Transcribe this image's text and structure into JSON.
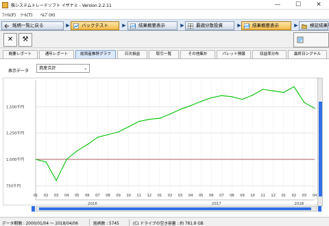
{
  "window": {
    "title": "株システムトレードソフト イザナミ - Version 2.2.11",
    "controls": [
      "—",
      "☐",
      "✕"
    ]
  },
  "menu": [
    "ﾌｧｲﾙ(F)",
    "ﾂｰﾙ(T)",
    "ﾍﾙﾌﾟ(H)"
  ],
  "nav": {
    "back": "銘柄一覧に戻る",
    "backtest": "バックテスト",
    "result_summary": "結果概要表示",
    "optimal_split": "最適分散投資",
    "active_summary": "結果概要表示",
    "verify_result": "検証結果を"
  },
  "tabs": [
    {
      "label": "概要レポート",
      "active": false
    },
    {
      "label": "通年レポート",
      "active": false
    },
    {
      "label": "総資産推移グラフ",
      "active": true
    },
    {
      "label": "日次損益",
      "active": false
    },
    {
      "label": "取引一覧",
      "active": false
    },
    {
      "label": "その他集計",
      "active": false
    },
    {
      "label": "パレット情報",
      "active": false
    },
    {
      "label": "収益率分布",
      "active": false
    },
    {
      "label": "最終日シグナル",
      "active": false
    }
  ],
  "display_data": {
    "label": "表示データ",
    "value": "資産合計"
  },
  "colors": {
    "line": "#00c000",
    "baseline": "#9a2a2a",
    "grid": "#d8d8d8",
    "accent": "#2f6ee6"
  },
  "chart_data": {
    "type": "line",
    "series": [
      {
        "name": "",
        "x": [
          "2016-01",
          "2016-02",
          "2016-03",
          "2016-04",
          "2016-05",
          "2016-06",
          "2016-07",
          "2016-08",
          "2016-09",
          "2016-10",
          "2016-11",
          "2016-12",
          "2017-01",
          "2017-02",
          "2017-03",
          "2017-04",
          "2017-05",
          "2017-06",
          "2017-07",
          "2017-08",
          "2017-09",
          "2017-10",
          "2017-11",
          "2017-12",
          "2018-01",
          "2018-02",
          "2018-03",
          "2018-04"
        ],
        "values": [
          1000,
          975,
          800,
          1000,
          1080,
          1140,
          1210,
          1235,
          1260,
          1310,
          1360,
          1380,
          1390,
          1430,
          1475,
          1510,
          1550,
          1585,
          1605,
          1595,
          1570,
          1610,
          1665,
          1650,
          1635,
          1690,
          1540,
          1485
        ]
      }
    ],
    "y_ticks": [
      "750千円",
      "1,000千円",
      "1,250千円",
      "1,500千円"
    ],
    "x_tick_labels": [
      "01",
      "02",
      "03",
      "04",
      "05",
      "06",
      "07",
      "08",
      "09",
      "10",
      "11",
      "12",
      "01",
      "02",
      "03",
      "04",
      "05",
      "06",
      "07",
      "08",
      "09",
      "10",
      "11",
      "12",
      "01",
      "02",
      "03",
      "04"
    ],
    "year_labels": [
      "2016",
      "2017",
      "2018"
    ],
    "ylim": [
      700,
      1750
    ],
    "baseline": 1000,
    "grid": true,
    "legend": "none"
  },
  "status": {
    "period": "データ期間 : 2000/01/04 〜 2018/04/06",
    "stock_count": "銘柄数 : 5745",
    "drive": "(C) ドライブの空き容量 : 約 781.8 GB"
  }
}
